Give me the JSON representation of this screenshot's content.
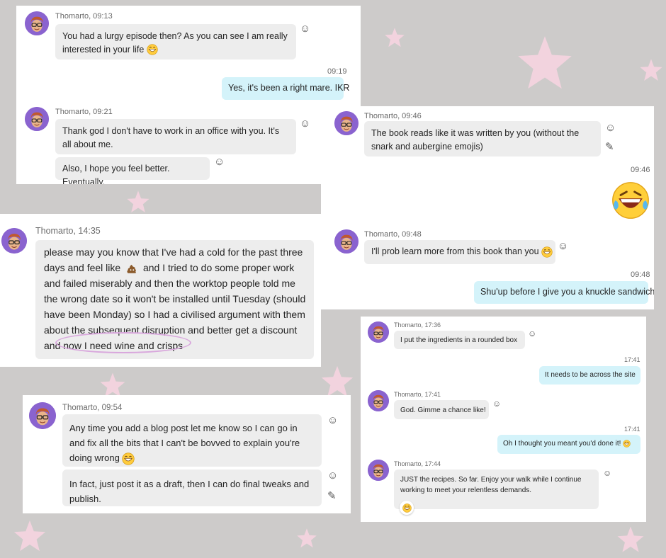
{
  "colors": {
    "background": "#cdcbca",
    "star": "#f2d3de",
    "incoming": "#ededed",
    "outgoing": "#d4f3fa",
    "avatar": "#8a63cf",
    "circle": "#d9a8dd"
  },
  "icons": {
    "reaction": "smiley-icon",
    "edit": "pencil-icon",
    "avatar": "memoji-avatar"
  },
  "c1": {
    "m1": {
      "meta": "Thomarto, 09:13",
      "text": "You had a lurgy episode then? As you can see I am really interested in your life"
    },
    "r1": {
      "time": "09:19",
      "text": "Yes, it's been a right mare. IKR"
    },
    "m2": {
      "meta": "Thomarto, 09:21",
      "text": "Thank god I don't have to work in an office with you. It's all about me."
    },
    "m3": {
      "text": "Also, I hope you feel better. Eventually."
    }
  },
  "c2": {
    "m1": {
      "meta": "Thomarto, 09:46",
      "text": "The book reads like it was written by you (without the snark and aubergine emojis)"
    },
    "r1": {
      "time": "09:46"
    },
    "m2": {
      "meta": "Thomarto, 09:48",
      "text": "I'll prob learn more from this book than you"
    },
    "r2": {
      "time": "09:48",
      "text": "Shu'up before I give you a knuckle sandwich"
    }
  },
  "c3": {
    "meta": "Thomarto, 14:35",
    "l1": "please may you know that I've had a cold for the past three",
    "l2a": "days and feel like",
    "l2b": "and I tried to do some proper work",
    "l3": "and failed miserably and then the worktop people told me",
    "l4": "the wrong date so it won't be installed until Tuesday (should",
    "l5": "have been Monday) so I had a civilised argument with them",
    "l6": "about the subsequent disruption and better get a discount",
    "l7": "and now I need wine and crisps"
  },
  "c4": {
    "m1": {
      "meta": "Thomarto, 09:54",
      "text": "Any time you add a blog post let me know so I can go in and fix all the bits that I can't be bovved to explain you're doing wrong"
    },
    "m2": {
      "text": "In fact, just post it as a draft, then I can do final tweaks and publish."
    }
  },
  "c5": {
    "m1": {
      "meta": "Thomarto, 17:36",
      "text": "I put the ingredients in a rounded box"
    },
    "r1": {
      "time": "17:41",
      "text": "It needs to be across the site"
    },
    "m2": {
      "meta": "Thomarto, 17:41",
      "text": "God. Gimme a chance like!"
    },
    "r2": {
      "time": "17:41",
      "text": "Oh I thought you meant you'd done it!"
    },
    "m3": {
      "meta": "Thomarto, 17:44",
      "text": "JUST the recipes. So far. Enjoy your walk while I continue working to meet your relentless demands."
    }
  }
}
